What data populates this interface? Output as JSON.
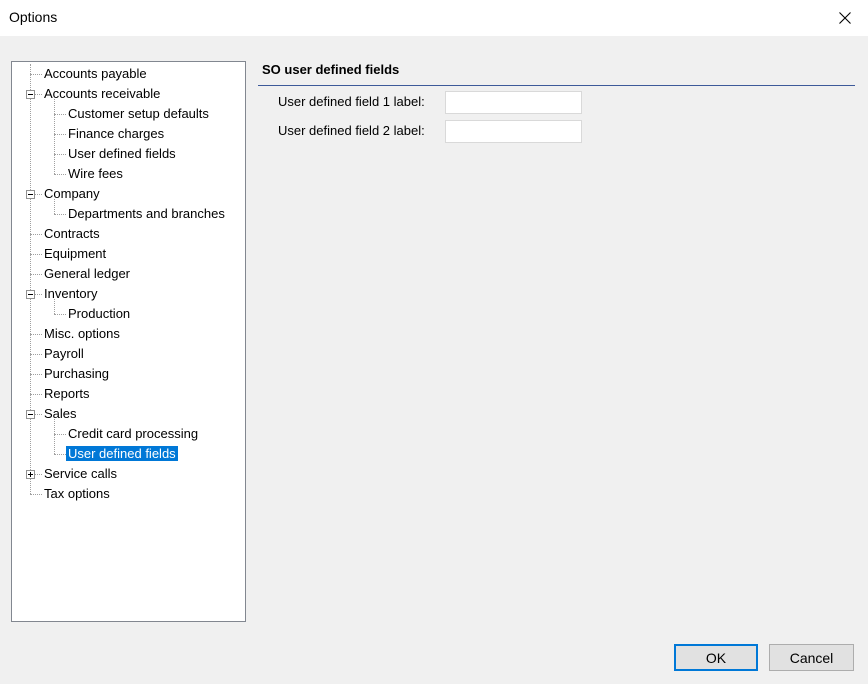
{
  "window": {
    "title": "Options"
  },
  "tree": {
    "items": [
      {
        "label": "Accounts payable",
        "level": 0,
        "has_children": false,
        "expanded": false
      },
      {
        "label": "Accounts receivable",
        "level": 0,
        "has_children": true,
        "expanded": true
      },
      {
        "label": "Customer setup defaults",
        "level": 1
      },
      {
        "label": "Finance charges",
        "level": 1
      },
      {
        "label": "User defined fields",
        "level": 1
      },
      {
        "label": "Wire fees",
        "level": 1
      },
      {
        "label": "Company",
        "level": 0,
        "has_children": true,
        "expanded": true
      },
      {
        "label": "Departments and branches",
        "level": 1
      },
      {
        "label": "Contracts",
        "level": 0
      },
      {
        "label": "Equipment",
        "level": 0
      },
      {
        "label": "General ledger",
        "level": 0
      },
      {
        "label": "Inventory",
        "level": 0,
        "has_children": true,
        "expanded": true
      },
      {
        "label": "Production",
        "level": 1
      },
      {
        "label": "Misc. options",
        "level": 0
      },
      {
        "label": "Payroll",
        "level": 0
      },
      {
        "label": "Purchasing",
        "level": 0
      },
      {
        "label": "Reports",
        "level": 0
      },
      {
        "label": "Sales",
        "level": 0,
        "has_children": true,
        "expanded": true
      },
      {
        "label": "Credit card processing",
        "level": 1
      },
      {
        "label": "User defined fields",
        "level": 1,
        "selected": true
      },
      {
        "label": "Service calls",
        "level": 0,
        "has_children": true,
        "expanded": false
      },
      {
        "label": "Tax options",
        "level": 0
      }
    ]
  },
  "panel": {
    "title": "SO user defined fields",
    "fields": [
      {
        "label": "User defined field 1 label:",
        "value": ""
      },
      {
        "label": "User defined field 2 label:",
        "value": ""
      }
    ]
  },
  "buttons": {
    "ok": "OK",
    "cancel": "Cancel"
  },
  "colors": {
    "selection": "#0078d7",
    "rule": "#3d5a99",
    "background": "#f0f0f0"
  }
}
